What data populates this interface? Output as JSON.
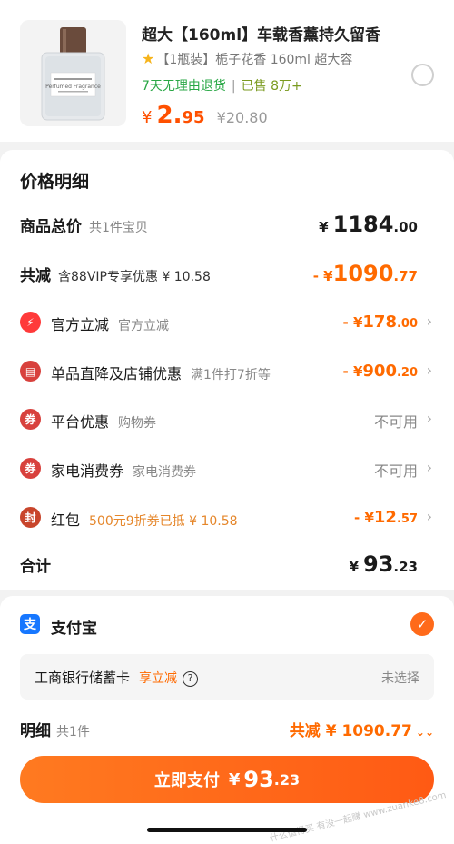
{
  "product": {
    "title": "超大【160ml】车载香薰持久留香",
    "spec": "【1瓶装】栀子花香 160ml 超大容",
    "return_policy": "7天无理由退货",
    "sold": "已售 8万+",
    "price_yen": "¥",
    "price_int": "2.",
    "price_dec": "95",
    "original_price": "¥20.80",
    "bottle_label": "Perfumed Fragrance"
  },
  "price_detail": {
    "title": "价格明细",
    "total": {
      "label": "商品总价",
      "sub": "共1件宝贝",
      "yen": "¥",
      "int": "1184",
      "dec": ".00"
    },
    "reduced": {
      "label": "共减",
      "sub": "含88VIP专享优惠 ¥ 10.58",
      "prefix": "- ¥",
      "int": "1090",
      "dec": ".77"
    },
    "items": [
      {
        "icon": "⚡",
        "label": "官方立减",
        "sub": "官方立减",
        "value_prefix": "- ¥",
        "value_int": "178",
        "value_dec": ".00"
      },
      {
        "icon": "▤",
        "label": "单品直降及店铺优惠",
        "sub": "满1件打7折等",
        "value_prefix": "- ¥",
        "value_int": "900",
        "value_dec": ".20"
      },
      {
        "icon": "券",
        "label": "平台优惠",
        "sub": "购物券",
        "value_text": "不可用"
      },
      {
        "icon": "券",
        "label": "家电消费券",
        "sub": "家电消费券",
        "value_text": "不可用"
      },
      {
        "icon": "封",
        "label": "红包",
        "sub": "500元9折券已抵 ¥ 10.58",
        "value_prefix": "- ¥",
        "value_int": "12",
        "value_dec": ".57"
      }
    ],
    "sum": {
      "label": "合计",
      "yen": "¥",
      "int": "93",
      "dec": ".23"
    }
  },
  "payment": {
    "method": "支付宝",
    "alipay_glyph": "支",
    "bank": "工商银行储蓄卡",
    "bank_promo": "享立减",
    "help_glyph": "?",
    "bank_select": "未选择",
    "summary_label": "明细",
    "summary_count": "共1件",
    "summary_reduce": "共减 ¥ 1090.77",
    "summary_glyph": "⌄⌄",
    "check_glyph": "✓",
    "chevron_glyph": "›"
  },
  "pay_button": {
    "label": "立即支付",
    "yen": "¥",
    "int": "93",
    "dec": ".23"
  },
  "watermark": "什么值得买 有没一起赚 www.zuanke8.com",
  "colors": {
    "accent": "#ff6a00",
    "alipay": "#1677ff",
    "green": "#29a745"
  }
}
